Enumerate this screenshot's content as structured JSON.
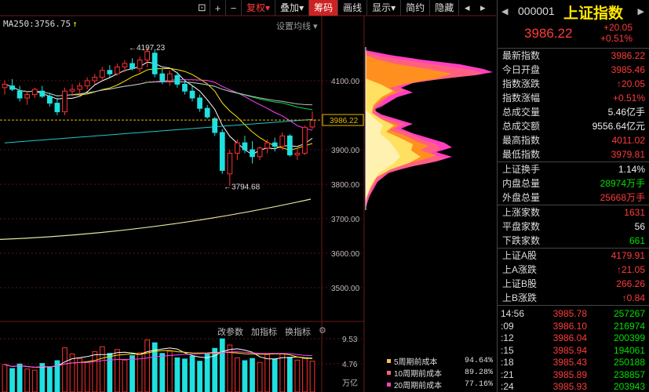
{
  "toolbar": {
    "buttons": [
      {
        "label": "复权",
        "chevron": "▾"
      },
      {
        "label": "叠加",
        "chevron": "▾"
      },
      {
        "label": "筹码"
      },
      {
        "label": "画线"
      },
      {
        "label": "显示",
        "chevron": "▾"
      },
      {
        "label": "简约"
      },
      {
        "label": "隐藏"
      }
    ]
  },
  "ma_label": "MA250:3756.75",
  "ma_arrow": "↑",
  "setting_ma": "设置均线 ▾",
  "price_axis": [
    "4100.00",
    "3900.00",
    "3800.00",
    "3700.00",
    "3600.00",
    "3500.00"
  ],
  "current_price_tag": "3986.22",
  "annotations": {
    "high": "4197.23",
    "low": "3794.68"
  },
  "volume_axis": [
    "9.53",
    "4.76",
    "万亿"
  ],
  "volume_tabs": [
    "改参数",
    "加指标",
    "换指标"
  ],
  "cost_legend": [
    {
      "label": "5周期前成本",
      "value": "94.64%",
      "color": "#ffc04a"
    },
    {
      "label": "10周期前成本",
      "value": "89.28%",
      "color": "#ff6080"
    },
    {
      "label": "20周期前成本",
      "value": "77.16%",
      "color": "#ff40c0"
    }
  ],
  "header": {
    "code": "000001",
    "name": "上证指数",
    "price": "3986.22",
    "change": "+20.05",
    "change_pct": "+0.51%"
  },
  "stats1": [
    {
      "k": "最新指数",
      "v": "3986.22",
      "c": "red"
    },
    {
      "k": "今日开盘",
      "v": "3985.46",
      "c": "red"
    },
    {
      "k": "指数涨跌",
      "v": "↑20.05",
      "c": "red"
    },
    {
      "k": "指数涨幅",
      "v": "+0.51%",
      "c": "red"
    },
    {
      "k": "总成交量",
      "v": "5.46亿手",
      "c": "white"
    },
    {
      "k": "总成交额",
      "v": "9556.64亿元",
      "c": "white"
    },
    {
      "k": "最高指数",
      "v": "4011.02",
      "c": "red"
    },
    {
      "k": "最低指数",
      "v": "3979.81",
      "c": "red"
    }
  ],
  "stats2": [
    {
      "k": "上证换手",
      "v": "1.14%",
      "c": "white"
    },
    {
      "k": "内盘总量",
      "v": "28974万手",
      "c": "green"
    },
    {
      "k": "外盘总量",
      "v": "25668万手",
      "c": "red"
    }
  ],
  "stats3": [
    {
      "k": "上涨家数",
      "v": "1631",
      "c": "red"
    },
    {
      "k": "平盘家数",
      "v": "56",
      "c": "white"
    },
    {
      "k": "下跌家数",
      "v": "661",
      "c": "green"
    }
  ],
  "stats4": [
    {
      "k": "上证A股",
      "v": "4179.91",
      "c": "red"
    },
    {
      "k": "上A涨跌",
      "v": "↑21.05",
      "c": "red"
    },
    {
      "k": "上证B股",
      "v": "266.26",
      "c": "red"
    },
    {
      "k": "上B涨跌",
      "v": "↑0.84",
      "c": "red"
    }
  ],
  "ticks": [
    {
      "t": "14:56",
      "p": "3985.78",
      "q": "257267"
    },
    {
      "t": ":09",
      "p": "3986.10",
      "q": "216974"
    },
    {
      "t": ":12",
      "p": "3986.04",
      "q": "200399"
    },
    {
      "t": ":15",
      "p": "3985.94",
      "q": "194061"
    },
    {
      "t": ":18",
      "p": "3985.43",
      "q": "250188"
    },
    {
      "t": ":21",
      "p": "3985.89",
      "q": "238857"
    },
    {
      "t": ":24",
      "p": "3985.93",
      "q": "203943"
    }
  ],
  "chart_data": {
    "type": "candlestick",
    "price_range": [
      3450,
      4230
    ],
    "candles": [
      {
        "o": 4080,
        "h": 4100,
        "l": 4060,
        "c": 4090
      },
      {
        "o": 4085,
        "h": 4105,
        "l": 4070,
        "c": 4075
      },
      {
        "o": 4070,
        "h": 4085,
        "l": 4040,
        "c": 4050
      },
      {
        "o": 4050,
        "h": 4070,
        "l": 4030,
        "c": 4060
      },
      {
        "o": 4060,
        "h": 4080,
        "l": 4050,
        "c": 4075
      },
      {
        "o": 4070,
        "h": 4085,
        "l": 4050,
        "c": 4055
      },
      {
        "o": 4055,
        "h": 4065,
        "l": 4025,
        "c": 4035
      },
      {
        "o": 4035,
        "h": 4050,
        "l": 4000,
        "c": 4010
      },
      {
        "o": 4010,
        "h": 4080,
        "l": 4000,
        "c": 4070
      },
      {
        "o": 4070,
        "h": 4090,
        "l": 4055,
        "c": 4075
      },
      {
        "o": 4075,
        "h": 4095,
        "l": 4060,
        "c": 4085
      },
      {
        "o": 4085,
        "h": 4110,
        "l": 4075,
        "c": 4100
      },
      {
        "o": 4100,
        "h": 4120,
        "l": 4090,
        "c": 4110
      },
      {
        "o": 4110,
        "h": 4140,
        "l": 4100,
        "c": 4130
      },
      {
        "o": 4130,
        "h": 4145,
        "l": 4110,
        "c": 4120
      },
      {
        "o": 4120,
        "h": 4150,
        "l": 4115,
        "c": 4140
      },
      {
        "o": 4140,
        "h": 4160,
        "l": 4125,
        "c": 4150
      },
      {
        "o": 4150,
        "h": 4165,
        "l": 4130,
        "c": 4135
      },
      {
        "o": 4135,
        "h": 4170,
        "l": 4125,
        "c": 4160
      },
      {
        "o": 4160,
        "h": 4197,
        "l": 4140,
        "c": 4185
      },
      {
        "o": 4180,
        "h": 4190,
        "l": 4110,
        "c": 4120
      },
      {
        "o": 4120,
        "h": 4135,
        "l": 4090,
        "c": 4100
      },
      {
        "o": 4100,
        "h": 4130,
        "l": 4085,
        "c": 4120
      },
      {
        "o": 4115,
        "h": 4125,
        "l": 4080,
        "c": 4090
      },
      {
        "o": 4090,
        "h": 4105,
        "l": 4060,
        "c": 4070
      },
      {
        "o": 4070,
        "h": 4085,
        "l": 4040,
        "c": 4050
      },
      {
        "o": 4050,
        "h": 4060,
        "l": 4010,
        "c": 4020
      },
      {
        "o": 4020,
        "h": 4030,
        "l": 3990,
        "c": 3995
      },
      {
        "o": 3990,
        "h": 3995,
        "l": 3940,
        "c": 3950
      },
      {
        "o": 3950,
        "h": 3960,
        "l": 3830,
        "c": 3840
      },
      {
        "o": 3830,
        "h": 3900,
        "l": 3795,
        "c": 3890
      },
      {
        "o": 3890,
        "h": 3930,
        "l": 3870,
        "c": 3920
      },
      {
        "o": 3920,
        "h": 3940,
        "l": 3890,
        "c": 3900
      },
      {
        "o": 3900,
        "h": 3925,
        "l": 3860,
        "c": 3880
      },
      {
        "o": 3880,
        "h": 3910,
        "l": 3870,
        "c": 3905
      },
      {
        "o": 3905,
        "h": 3930,
        "l": 3890,
        "c": 3920
      },
      {
        "o": 3920,
        "h": 3935,
        "l": 3895,
        "c": 3910
      },
      {
        "o": 3910,
        "h": 3950,
        "l": 3900,
        "c": 3940
      },
      {
        "o": 3940,
        "h": 3945,
        "l": 3880,
        "c": 3885
      },
      {
        "o": 3885,
        "h": 3905,
        "l": 3870,
        "c": 3890
      },
      {
        "o": 3890,
        "h": 3970,
        "l": 3885,
        "c": 3965
      },
      {
        "o": 3966,
        "h": 4011,
        "l": 3960,
        "c": 3986
      }
    ],
    "volumes": [
      4.9,
      4.2,
      5.0,
      4.1,
      3.9,
      5.1,
      4.4,
      5.6,
      7.9,
      6.8,
      6.0,
      5.4,
      7.2,
      8.1,
      6.9,
      7.6,
      5.7,
      6.5,
      7.0,
      9.3,
      8.8,
      6.9,
      7.3,
      6.1,
      5.9,
      6.4,
      5.5,
      6.8,
      7.8,
      9.5,
      8.4,
      6.1,
      5.6,
      6.0,
      5.3,
      6.7,
      5.9,
      6.8,
      6.2,
      5.7,
      6.0,
      5.5
    ],
    "volume_max": 9.53,
    "ma250_start": 3640,
    "ma250_end": 3756.75
  }
}
